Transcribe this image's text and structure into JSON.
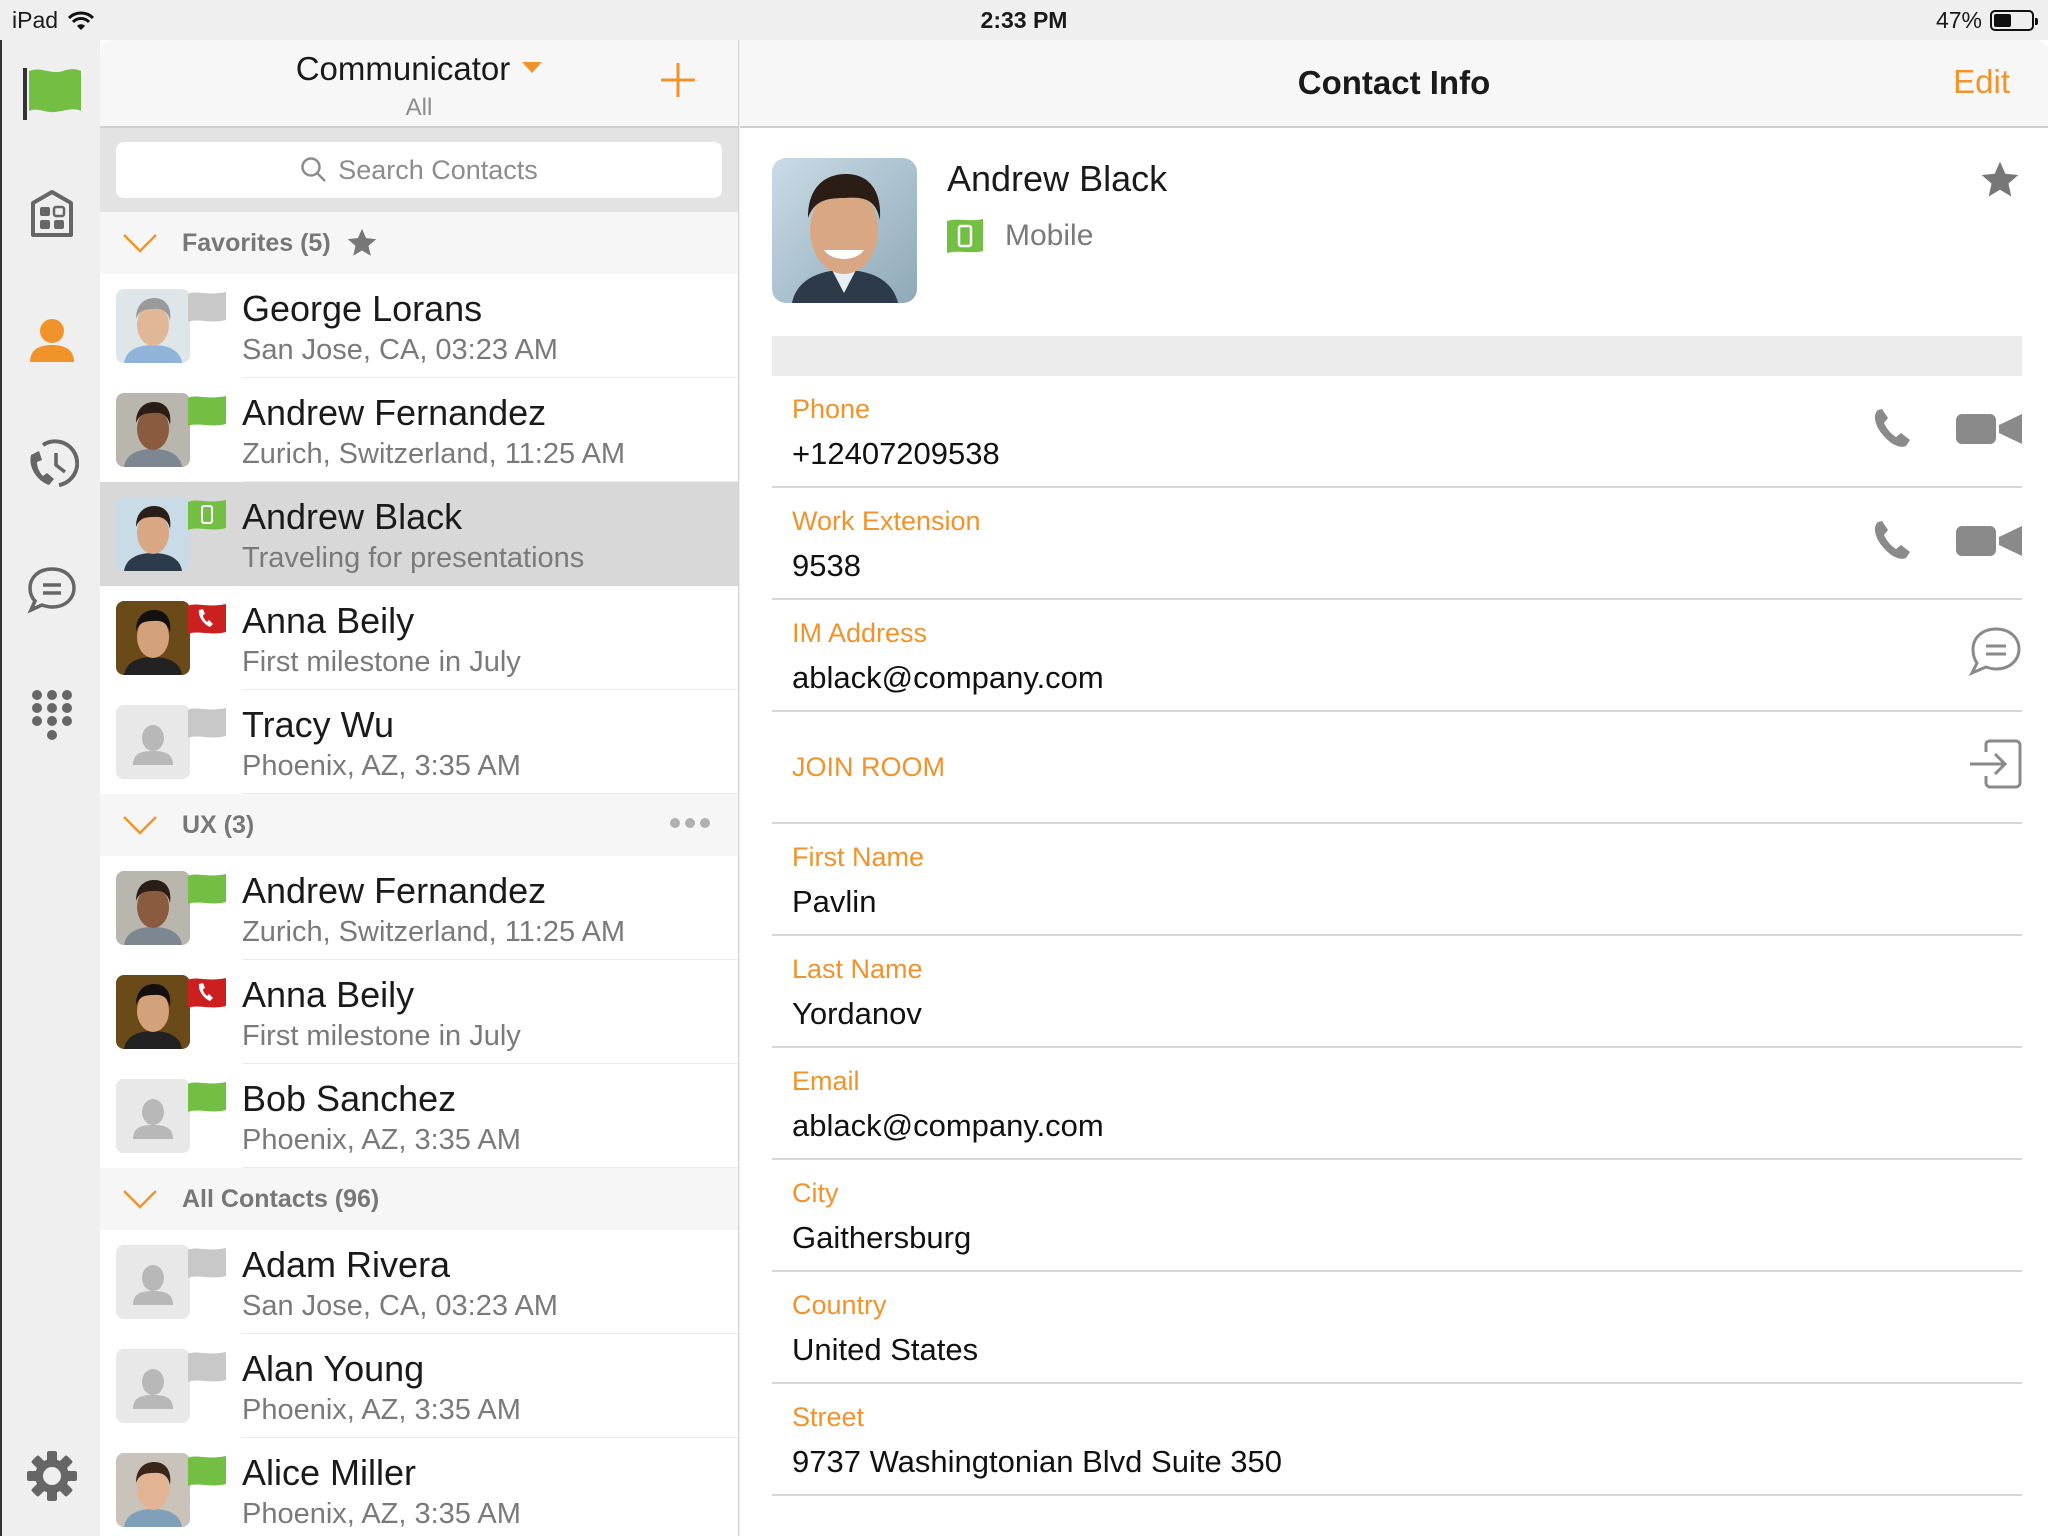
{
  "status_bar": {
    "device": "iPad",
    "time": "2:33 PM",
    "battery_text": "47%",
    "battery_level": 0.47
  },
  "colors": {
    "accent": "#f0932b",
    "available": "#72bf44",
    "busy": "#cc1f1f",
    "offline": "#c8c8c8"
  },
  "rail": {
    "items": [
      {
        "name": "presence-flag",
        "icon": "green-flag-icon",
        "active": false
      },
      {
        "name": "rooms",
        "icon": "building-icon",
        "active": false
      },
      {
        "name": "contacts",
        "icon": "person-icon",
        "active": true
      },
      {
        "name": "recents",
        "icon": "call-history-icon",
        "active": false
      },
      {
        "name": "chat",
        "icon": "chat-bubble-icon",
        "active": false
      },
      {
        "name": "dialpad",
        "icon": "dialpad-icon",
        "active": false
      },
      {
        "name": "settings",
        "icon": "gear-icon",
        "active": false
      }
    ]
  },
  "list": {
    "title": "Communicator",
    "subtitle": "All",
    "add_icon": "plus-icon",
    "search_placeholder": "Search Contacts",
    "groups": [
      {
        "title": "Favorites (5)",
        "has_star": true,
        "has_more": false,
        "contacts": [
          {
            "name": "George Lorans",
            "sub": "San Jose, CA, 03:23 AM",
            "status": "offline",
            "avatar": "photo-gray-hair-man",
            "selected": false
          },
          {
            "name": "Andrew Fernandez",
            "sub": "Zurich, Switzerland, 11:25 AM",
            "status": "available",
            "avatar": "photo-man-bald",
            "selected": false
          },
          {
            "name": "Andrew Black",
            "sub": "Traveling for presentations",
            "status": "mobile",
            "avatar": "photo-smiling-man",
            "selected": true
          },
          {
            "name": "Anna Beily",
            "sub": "First milestone in July",
            "status": "on-call",
            "avatar": "photo-woman-phone",
            "selected": false
          },
          {
            "name": "Tracy Wu",
            "sub": "Phoenix, AZ, 3:35 AM",
            "status": "offline",
            "avatar": "placeholder",
            "selected": false
          }
        ]
      },
      {
        "title": "UX (3)",
        "has_star": false,
        "has_more": true,
        "contacts": [
          {
            "name": "Andrew Fernandez",
            "sub": "Zurich, Switzerland, 11:25 AM",
            "status": "available",
            "avatar": "photo-man-bald",
            "selected": false
          },
          {
            "name": "Anna Beily",
            "sub": "First milestone in July",
            "status": "on-call",
            "avatar": "photo-woman-phone",
            "selected": false
          },
          {
            "name": "Bob Sanchez",
            "sub": "Phoenix, AZ, 3:35 AM",
            "status": "available",
            "avatar": "placeholder",
            "selected": false
          }
        ]
      },
      {
        "title": "All Contacts (96)",
        "has_star": false,
        "has_more": false,
        "contacts": [
          {
            "name": "Adam Rivera",
            "sub": "San Jose, CA, 03:23 AM",
            "status": "offline",
            "avatar": "placeholder",
            "selected": false
          },
          {
            "name": "Alan Young",
            "sub": "Phoenix, AZ, 3:35 AM",
            "status": "offline",
            "avatar": "placeholder",
            "selected": false
          },
          {
            "name": "Alice Miller",
            "sub": "Phoenix, AZ, 3:35 AM",
            "status": "available",
            "avatar": "photo-woman-smiling",
            "selected": false
          }
        ]
      }
    ]
  },
  "detail": {
    "title": "Contact Info",
    "edit_label": "Edit",
    "contact": {
      "name": "Andrew Black",
      "status_text": "Mobile",
      "favorite": true
    },
    "fields": [
      {
        "label": "Phone",
        "value": "+12407209538",
        "actions": [
          "phone-icon",
          "video-camera-icon"
        ]
      },
      {
        "label": "Work Extension",
        "value": "9538",
        "actions": [
          "phone-icon",
          "video-camera-icon"
        ]
      },
      {
        "label": "IM Address",
        "value": "ablack@company.com",
        "actions": [
          "chat-bubble-icon"
        ]
      },
      {
        "label": "JOIN ROOM",
        "value": "",
        "actions": [
          "join-room-icon"
        ],
        "join": true
      },
      {
        "label": "First Name",
        "value": "Pavlin",
        "actions": []
      },
      {
        "label": "Last Name",
        "value": "Yordanov",
        "actions": []
      },
      {
        "label": "Email",
        "value": "ablack@company.com",
        "actions": []
      },
      {
        "label": "City",
        "value": "Gaithersburg",
        "actions": []
      },
      {
        "label": "Country",
        "value": "United States",
        "actions": []
      },
      {
        "label": "Street",
        "value": "9737 Washingtonian Blvd Suite 350",
        "actions": []
      }
    ]
  }
}
